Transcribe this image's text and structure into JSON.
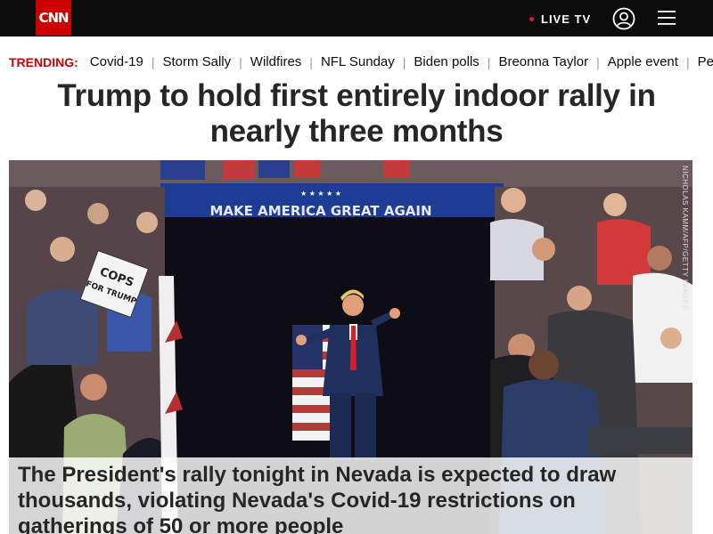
{
  "header": {
    "logo_text": "CNN",
    "live_tv_label": "LIVE TV",
    "user_icon": "user-icon",
    "menu_icon": "hamburger-menu-icon",
    "brand_color": "#cc0000"
  },
  "trending": {
    "label": "TRENDING:",
    "items": [
      "Covid-19",
      "Storm Sally",
      "Wildfires",
      "NFL Sunday",
      "Biden polls",
      "Breonna Taylor",
      "Apple event",
      "Peeps"
    ]
  },
  "article": {
    "headline": "Trump to hold first entirely indoor rally in nearly three months",
    "image_credit": "NICHOLAS KAMM/AFP/GETTY IMAGES",
    "image_caption": "The President's rally tonight in Nevada is expected to draw thousands, violating Nevada's Covid-19 restrictions on gatherings of 50 or more people",
    "sign_text": "COPS FOR TRUMP",
    "banner_text": "MAKE AMERICA GREAT AGAIN"
  }
}
